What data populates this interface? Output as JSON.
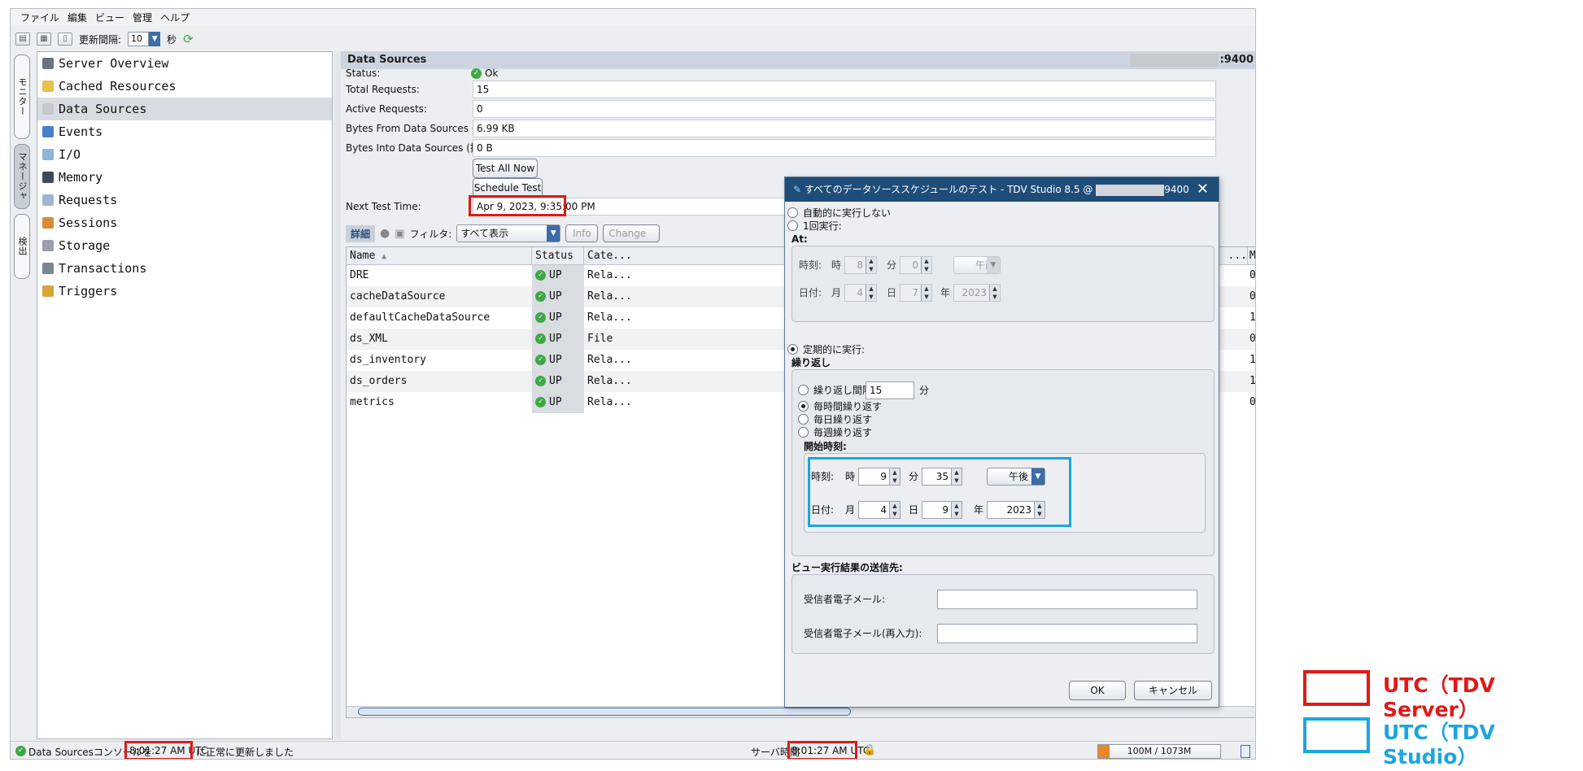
{
  "menu": [
    "ファイル",
    "編集",
    "ビュー",
    "管理",
    "ヘルプ"
  ],
  "toolbar": {
    "refresh_label": "更新間隔:",
    "refresh_value": "10",
    "unit": "秒"
  },
  "vtabs": [
    "モニター",
    "マネージャ",
    "検出"
  ],
  "tree": [
    "Server Overview",
    "Cached Resources",
    "Data Sources",
    "Events",
    "I/O",
    "Memory",
    "Requests",
    "Sessions",
    "Storage",
    "Transactions",
    "Triggers"
  ],
  "panel": {
    "title": "Data Sources",
    "port": ":9400",
    "status_label": "Status:",
    "status_value": "Ok",
    "total_label": "Total Requests:",
    "total_value": "15",
    "active_label": "Active Requests:",
    "active_value": "0",
    "bytes_from_label": "Bytes From Data Sources (推定):",
    "bytes_from_value": "6.99 KB",
    "bytes_into_label": "Bytes Into Data Sources (推定):",
    "bytes_into_value": "0 B",
    "test_all_btn": "Test All Now",
    "schedule_btn": "Schedule Test",
    "next_test_label": "Next Test Time:",
    "next_test_value": "Apr 9, 2023, 9:35:00 PM"
  },
  "detail_bar": {
    "tab": "詳細",
    "filter_label": "フィルタ:",
    "filter_value": "すべて表示",
    "info_btn": "Info",
    "change_btn": "Change"
  },
  "table": {
    "headers": [
      "Name",
      "Status",
      "Cate..."
    ],
    "right_headers": [
      "...",
      "M"
    ],
    "rows": [
      {
        "name": "DRE",
        "status": "UP",
        "cat": "Rela...",
        "last": "0"
      },
      {
        "name": "cacheDataSource",
        "status": "UP",
        "cat": "Rela...",
        "last": "0"
      },
      {
        "name": "defaultCacheDataSource",
        "status": "UP",
        "cat": "Rela...",
        "last": "1"
      },
      {
        "name": "ds_XML",
        "status": "UP",
        "cat": "File",
        "last": "0"
      },
      {
        "name": "ds_inventory",
        "status": "UP",
        "cat": "Rela...",
        "last": "1"
      },
      {
        "name": "ds_orders",
        "status": "UP",
        "cat": "Rela...",
        "last": "1"
      },
      {
        "name": "metrics",
        "status": "UP",
        "cat": "Rela...",
        "last": "0"
      }
    ]
  },
  "statusbar": {
    "left_prefix": "Data Sourcesコンソールを",
    "left_time": "8:01:27 AM UTC",
    "left_suffix": "に正常に更新しました",
    "server_label": "サーバ時間",
    "server_time": "8:01:27 AM UTC",
    "memory": "100M / 1073M",
    "memory_fraction": 0.093
  },
  "dialog": {
    "title": "すべてのデータソーススケジュールのテスト - TDV Studio 8.5 @",
    "title_port": "9400",
    "opt_none": "自動的に実行しない",
    "opt_once": "1回実行:",
    "at_label": "At:",
    "once_time_label": "時刻:",
    "hour_label": "時",
    "once_hour": "8",
    "minute_label": "分",
    "once_minute": "0",
    "once_ampm": "午前",
    "date_label": "日付:",
    "month_label": "月",
    "once_month": "4",
    "day_label": "日",
    "once_day": "7",
    "year_label": "年",
    "once_year": "2023",
    "opt_periodic": "定期的に実行:",
    "repeat_label": "繰り返し",
    "repeat_interval": "繰り返し間隔",
    "repeat_interval_value": "15",
    "repeat_interval_unit": "分",
    "repeat_hourly": "毎時間繰り返す",
    "repeat_daily": "毎日繰り返す",
    "repeat_weekly": "毎週繰り返す",
    "start_label": "開始時刻:",
    "start_hour": "9",
    "start_minute": "35",
    "start_ampm": "午後",
    "start_month": "4",
    "start_day": "9",
    "start_year": "2023",
    "recipients_label": "ビュー実行結果の送信先:",
    "email_label": "受信者電子メール:",
    "email_confirm_label": "受信者電子メール(再入力):",
    "ok_btn": "OK",
    "cancel_btn": "キャンセル"
  },
  "legend": {
    "server": "UTC（TDV Server）",
    "studio": "UTC（TDV Studio）",
    "server_color": "#e21818",
    "studio_color": "#1aa6e0"
  }
}
